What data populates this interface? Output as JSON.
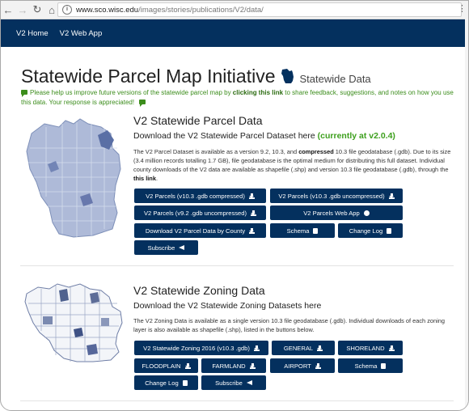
{
  "browser": {
    "url_host": "www.sco.wisc.edu",
    "url_path": "/images/stories/publications/V2/data/"
  },
  "nav": {
    "items": [
      "V2 Home",
      "V2 Web App"
    ]
  },
  "page": {
    "title": "Statewide Parcel Map Initiative",
    "subtitle": "Statewide Data",
    "notice_pre": "Please help us improve future versions of the statewide parcel map by ",
    "notice_link": "clicking this link",
    "notice_post": " to share feedback, suggestions, and notes on how you use this data. Your response is appreciated!"
  },
  "parcel": {
    "title": "V2 Statewide Parcel Data",
    "sub_pre": "Download the V2 Statewide Parcel Dataset here ",
    "sub_version": "(currently at v2.0.4)",
    "body_1": "The V2 Parcel Dataset is available as a version 9.2, 10.3, and ",
    "body_bold": "compressed",
    "body_2": " 10.3 file geodatabase (.gdb). Due to its size (3.4 million records totalling 1.7 GB), file geodatabase is the optimal medium for distributing this full dataset. Individual county downloads of the V2 data are available as shapefile (.shp) and version 10.3 file geodatabase (.gdb), through the ",
    "body_link": "this link",
    "body_end": ".",
    "buttons": [
      "V2 Parcels (v10.3 .gdb compressed)",
      "V2 Parcels (v10.3 .gdb uncompressed)",
      "V2 Parcels (v9.2 .gdb uncompressed)",
      "V2 Parcels Web App",
      "Download V2 Parcel Data by County",
      "Schema",
      "Change Log",
      "Subscribe"
    ]
  },
  "zoning": {
    "title": "V2 Statewide Zoning Data",
    "sub": "Download the V2 Statewide Zoning Datasets here",
    "body": "The V2 Zoning Data is available as a single version 10.3 file geodatabase (.gdb). Individual downloads of each zoning layer is also available as shapefile (.shp), listed in the buttons below.",
    "buttons": [
      "V2 Statewide Zoning 2016 (v10.3 .gdb)",
      "GENERAL",
      "SHORELAND",
      "FLOODPLAIN",
      "FARMLAND",
      "AIRPORT",
      "Schema",
      "Change Log",
      "Subscribe"
    ]
  },
  "colors": {
    "navbar": "#04305e",
    "button": "#04305e",
    "notice": "#3c8d1c",
    "version": "#3c9f1c"
  }
}
